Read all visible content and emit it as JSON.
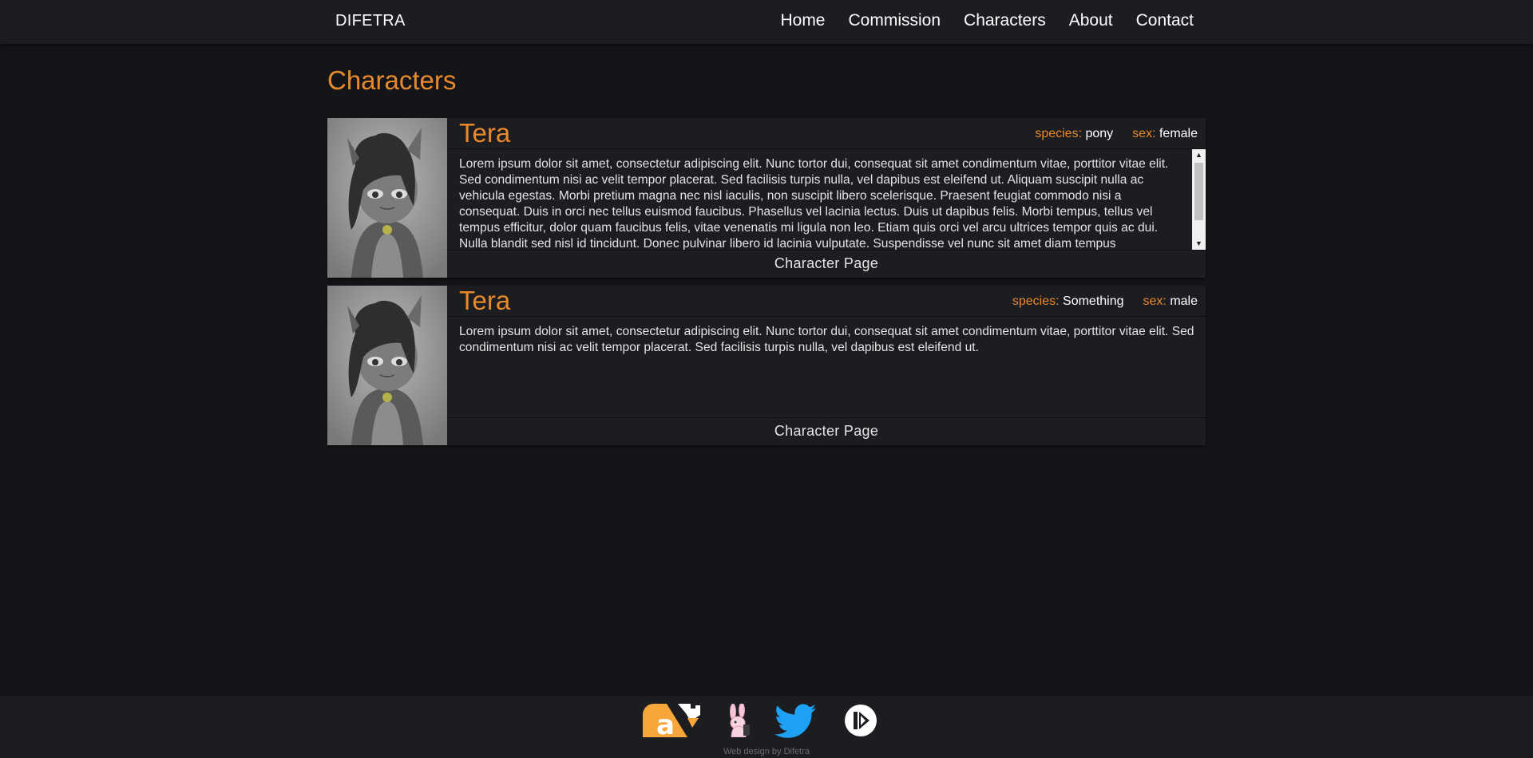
{
  "nav": {
    "brand": "DIFETRA",
    "links": [
      "Home",
      "Commission",
      "Characters",
      "About",
      "Contact"
    ]
  },
  "page": {
    "title": "Characters"
  },
  "characters": [
    {
      "name": "Tera",
      "species_label": "species:",
      "species": "pony",
      "sex_label": "sex:",
      "sex": "female",
      "description": "Lorem ipsum dolor sit amet, consectetur adipiscing elit. Nunc tortor dui, consequat sit amet condimentum vitae, porttitor vitae elit. Sed condimentum nisi ac velit tempor placerat. Sed facilisis turpis nulla, vel dapibus est eleifend ut. Aliquam suscipit nulla ac vehicula egestas. Morbi pretium magna nec nisl iaculis, non suscipit libero scelerisque. Praesent feugiat commodo nisi a consequat. Duis in orci nec tellus euismod faucibus. Phasellus vel lacinia lectus. Duis ut dapibus felis. Morbi tempus, tellus vel tempus efficitur, dolor quam faucibus felis, vitae venenatis mi ligula non leo. Etiam quis orci vel arcu ultrices tempor quis ac dui. Nulla blandit sed nisl id tincidunt. Donec pulvinar libero id lacinia vulputate. Suspendisse vel nunc sit amet diam tempus",
      "link": "Character Page"
    },
    {
      "name": "Tera",
      "species_label": "species:",
      "species": "Something",
      "sex_label": "sex:",
      "sex": "male",
      "description": "Lorem ipsum dolor sit amet, consectetur adipiscing elit. Nunc tortor dui, consequat sit amet condimentum vitae, porttitor vitae elit. Sed condimentum nisi ac velit tempor placerat. Sed facilisis turpis nulla, vel dapibus est eleifend ut.",
      "link": "Character Page"
    }
  ],
  "footer": {
    "icons": [
      "artstation-icon",
      "furaffinity-icon",
      "twitter-icon",
      "picarto-icon"
    ],
    "credit": "Web design by Difetra"
  },
  "colors": {
    "accent": "#e8892c",
    "background": "#141518",
    "panel": "#1c1d21",
    "twitter": "#1da1f2",
    "artstation_orange": "#f6a63a"
  }
}
